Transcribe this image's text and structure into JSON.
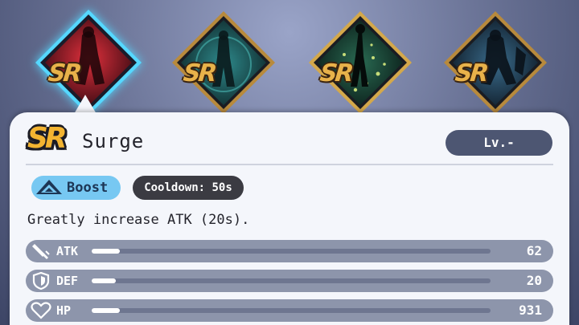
{
  "cards": [
    {
      "badge": "SR",
      "selected": true,
      "art": "red-figure-art",
      "bg": "#7a1824",
      "glow": "#e0303c"
    },
    {
      "badge": "SR",
      "selected": false,
      "art": "teal-figure-art",
      "bg": "#1d4a50",
      "glow": "#2e8a8c"
    },
    {
      "badge": "SR",
      "selected": false,
      "art": "green-figure-art",
      "bg": "#153a32",
      "glow": "#c8e070"
    },
    {
      "badge": "SR",
      "selected": false,
      "art": "blue-knight-art",
      "bg": "#1a3146",
      "glow": "#3a6c8c"
    }
  ],
  "skill": {
    "rarity": "SR",
    "name": "Surge",
    "level": "Lv.-",
    "type_label": "Boost",
    "cooldown": "Cooldown: 50s",
    "description": "Greatly increase ATK (20s)."
  },
  "stats": [
    {
      "label": "ATK",
      "value": "62",
      "fill": 0.07,
      "icon": "sword-icon"
    },
    {
      "label": "DEF",
      "value": "20",
      "fill": 0.06,
      "icon": "shield-icon"
    },
    {
      "label": "HP",
      "value": "931",
      "fill": 0.07,
      "icon": "heart-icon"
    }
  ],
  "colors": {
    "accent": "#55d8ff",
    "panel": "#f4f6fb",
    "pill_dark": "#4d5672",
    "boost": "#77c8f2",
    "stat_row": "#8d95ab",
    "badge_gold": "#f3b431"
  }
}
